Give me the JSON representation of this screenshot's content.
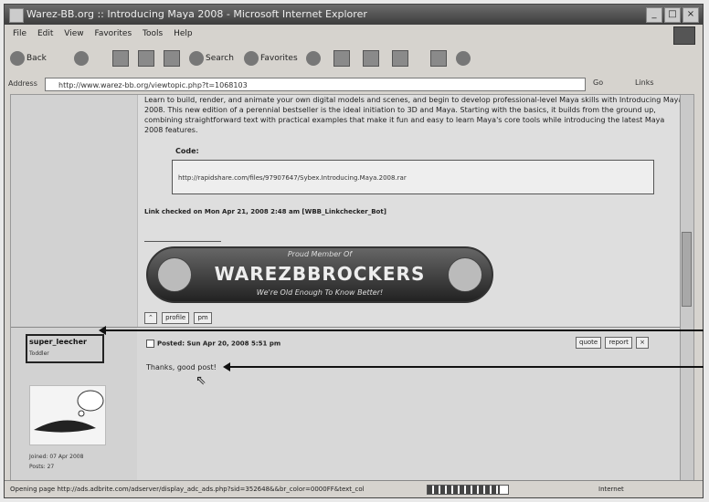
{
  "window": {
    "title": "Warez-BB.org :: Introducing Maya 2008 - Microsoft Internet Explorer",
    "controls": [
      "_",
      "□",
      "×"
    ]
  },
  "menubar": [
    "File",
    "Edit",
    "View",
    "Favorites",
    "Tools",
    "Help"
  ],
  "toolbar": {
    "back": "Back",
    "search": "Search",
    "favorites": "Favorites"
  },
  "address": {
    "label": "Address",
    "url": "http://www.warez-bb.org/viewtopic.php?t=1068103",
    "go": "Go",
    "links": "Links"
  },
  "post1": {
    "body": "Learn to build, render, and animate your own digital models and scenes, and begin to develop professional-level Maya skills with Introducing Maya 2008. This new edition of a perennial bestseller is the ideal initiation to 3D and Maya. Starting with the basics, it builds from the ground up, combining straightforward text with practical examples that make it fun and easy to learn Maya's core tools while introducing the latest Maya 2008 features.",
    "code_label": "Code:",
    "code_text": "http://rapidshare.com/files/97907647/Sybex.Introducing.Maya.2008.rar",
    "link_checked": "Link checked on Mon Apr 21, 2008 2:48 am [WBB_Linkchecker_Bot]",
    "banner": {
      "top": "Proud Member Of",
      "main": "WAREZBBROCKERS",
      "bottom": "We're Old Enough To Know Better!"
    },
    "buttons": [
      "profile",
      "pm"
    ]
  },
  "post2": {
    "username": "super_leecher",
    "rank": "Toddler",
    "joined": "Joined: 07 Apr 2008",
    "posts": "Posts: 27",
    "posted": "Posted: Sun Apr 20, 2008 5:51 pm",
    "buttons": [
      "quote",
      "report"
    ],
    "message": "Thanks, good post!"
  },
  "status": {
    "text": "Opening page http://ads.adbrite.com/adserver/display_adc_ads.php?sid=352648&&br_color=0000FF&text_col",
    "progress": 0.9,
    "zone": "Internet"
  }
}
